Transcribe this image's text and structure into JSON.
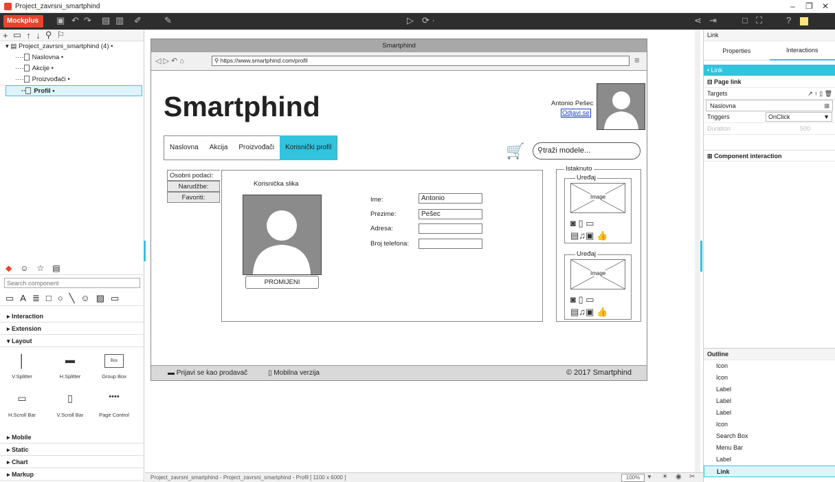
{
  "app": {
    "window_title": "Project_zavrsni_smartphind",
    "brand": "Mockplus"
  },
  "tree": {
    "project": "Project_zavrsni_smartphind (4)",
    "pages": [
      "Naslovna",
      "Akcije",
      "Proizvođači",
      "Profil"
    ],
    "selected": "Profil"
  },
  "components": {
    "search_placeholder": "Search component",
    "categories_top": [
      "Interaction",
      "Extension",
      "Layout"
    ],
    "layout_items": [
      "V.Splitter",
      "H.Splitter",
      "Group Box",
      "H.Scroll Bar",
      "V.Scroll Bar",
      "Page Control"
    ],
    "group_box_caption": "Box",
    "categories_bottom": [
      "Mobile",
      "Static",
      "Chart",
      "Markup"
    ]
  },
  "mockup": {
    "frame_title": "Smartphind",
    "url": "https://www.smartphind.com/profil",
    "logo": "Smartphind",
    "user_name": "Antonio Pešec",
    "logout": "Odjavi se",
    "nav": [
      "Naslovna",
      "Akcija",
      "Proizvođači",
      "Korisnički profil"
    ],
    "active_nav": "Korisnički profil",
    "search_placeholder": "traži modele...",
    "side_tabs": [
      "Osobni podaci:",
      "Narudžbe:",
      "Favoriti:"
    ],
    "photo_label": "Korisnička slika",
    "change_button": "PROMIJENI",
    "form": [
      {
        "label": "Ime:",
        "value": "Antonio"
      },
      {
        "label": "Prezime:",
        "value": "Pešec"
      },
      {
        "label": "Adresa:",
        "value": ""
      },
      {
        "label": "Broj telefona:",
        "value": ""
      }
    ],
    "featured_title": "Istaknuto",
    "device_title": "Uređaj",
    "image_label": "Image",
    "footer_seller": "Prijavi se kao prodavač",
    "footer_mobile": "Mobilna verzija",
    "copyright": "2017 Smartphind"
  },
  "status": {
    "path": "Project_zavrsni_smartphind - Project_zavrsni_smartphind - Profil [ 1100 x 6000 ]",
    "zoom": "100%"
  },
  "right": {
    "header": "Link",
    "tabs": [
      "Properties",
      "Interactions"
    ],
    "active_tab": "Interactions",
    "link_row": "Link",
    "page_link": "Page link",
    "targets_label": "Targets",
    "target_value": "Naslovna",
    "triggers_label": "Triggers",
    "trigger_value": "OnClick",
    "duration_label": "Duration",
    "duration_value": "500",
    "component_interaction": "Component interaction",
    "outline_title": "Outline",
    "outline_items": [
      "Icon",
      "Icon",
      "Label",
      "Label",
      "Label",
      "Icon",
      "Search Box",
      "Menu Bar",
      "Label",
      "Link"
    ],
    "outline_selected": "Link"
  },
  "colors": {
    "accent": "#32c3dd",
    "brand": "#e8442d"
  }
}
